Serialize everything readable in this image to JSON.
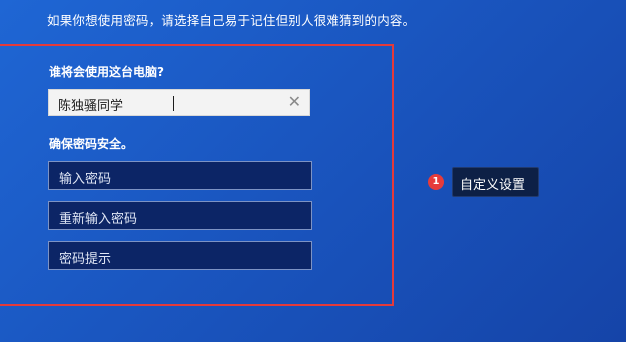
{
  "page": {
    "hint": "如果你想使用密码，请选择自己易于记住但别人很难猜到的内容。"
  },
  "form": {
    "who_label": "谁将会使用这台电脑?",
    "name_value": "陈独骚同学",
    "clear_glyph": "✕",
    "security_label": "确保密码安全。",
    "password_placeholder": "输入密码",
    "confirm_placeholder": "重新输入密码",
    "hint_placeholder": "密码提示"
  },
  "annotation": {
    "number": "1",
    "label": "自定义设置"
  },
  "colors": {
    "background": "#1a56c0",
    "highlight_border": "#e53a3a",
    "field_background": "#0c2566",
    "callout_background": "#0d2046",
    "callout_dot": "#e63b3b"
  }
}
